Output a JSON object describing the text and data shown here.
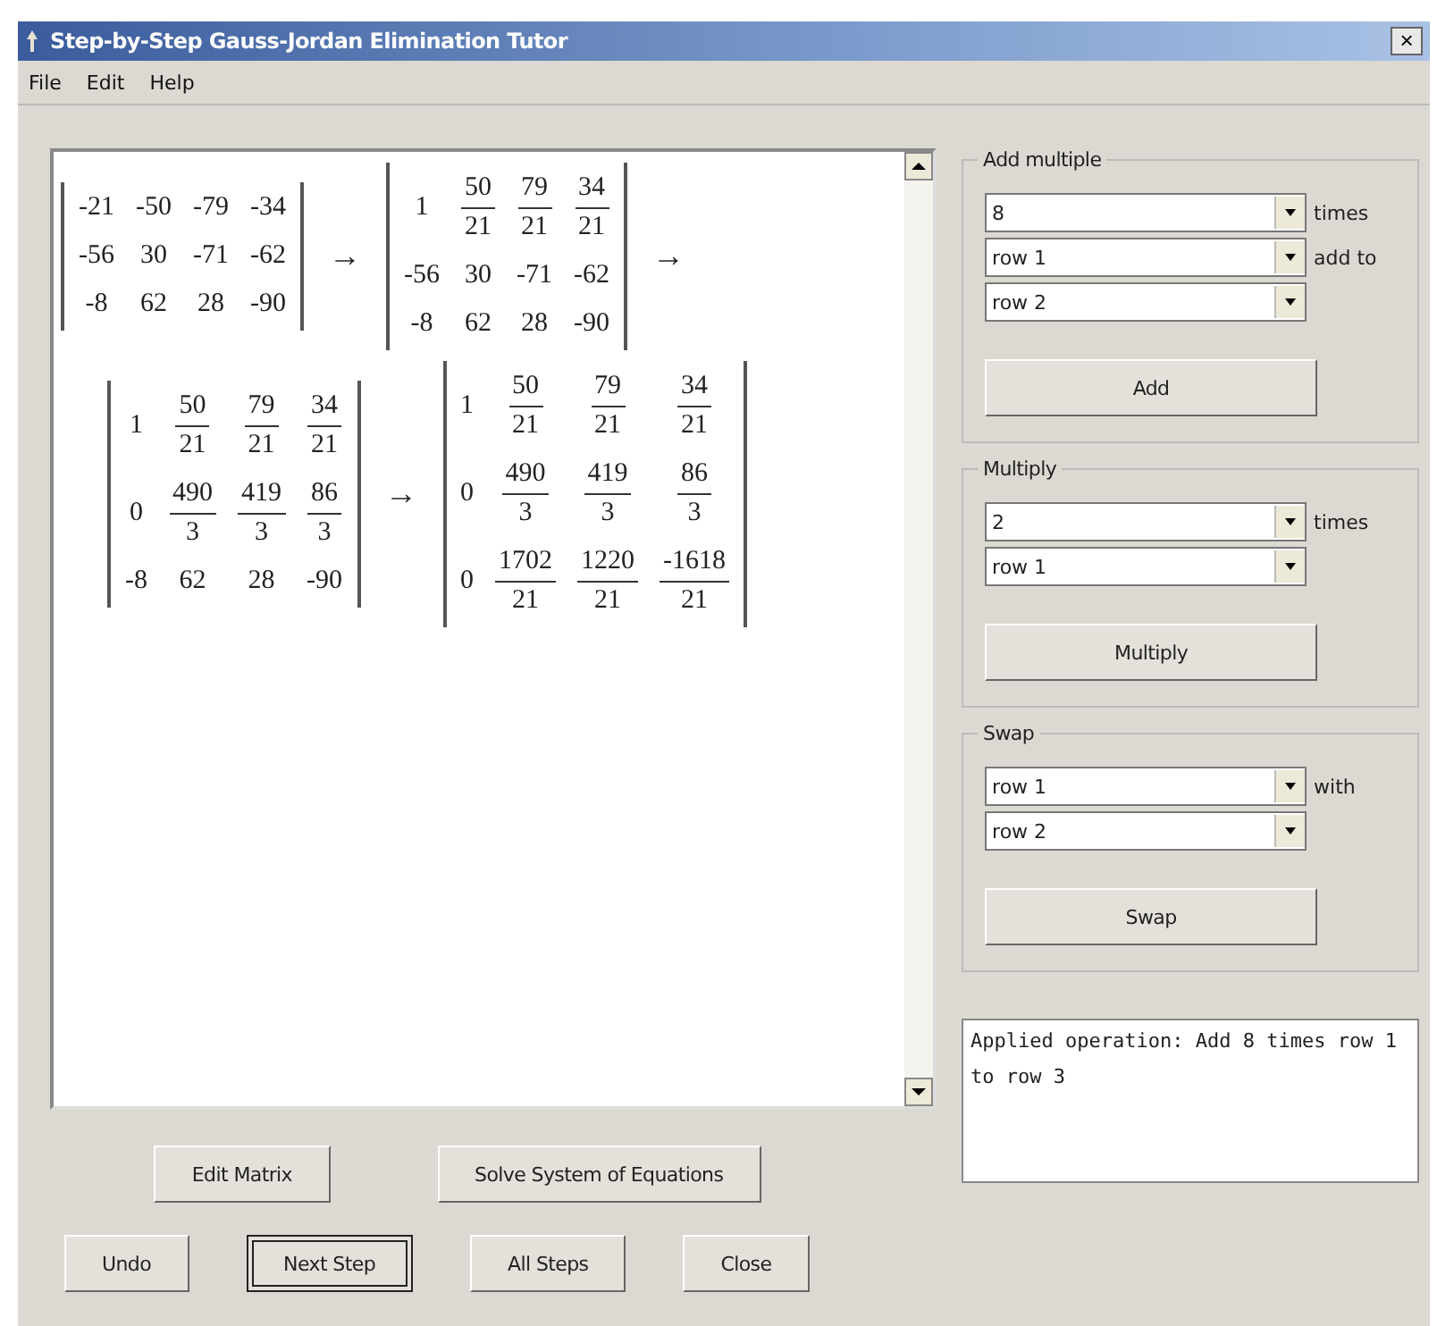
{
  "window": {
    "title": "Step-by-Step Gauss-Jordan Elimination Tutor",
    "close": "×"
  },
  "menu": [
    "File",
    "Edit",
    "Help"
  ],
  "steps": [
    [
      {
        "kind": "matrix",
        "rows": [
          [
            {
              "kind": "int",
              "text": "-21"
            },
            {
              "kind": "int",
              "text": "-50"
            },
            {
              "kind": "int",
              "text": "-79"
            },
            {
              "kind": "int",
              "text": "-34"
            }
          ],
          [
            {
              "kind": "int",
              "text": "-56"
            },
            {
              "kind": "int",
              "text": "30"
            },
            {
              "kind": "int",
              "text": "-71"
            },
            {
              "kind": "int",
              "text": "-62"
            }
          ],
          [
            {
              "kind": "int",
              "text": "-8"
            },
            {
              "kind": "int",
              "text": "62"
            },
            {
              "kind": "int",
              "text": "28"
            },
            {
              "kind": "int",
              "text": "-90"
            }
          ]
        ]
      },
      {
        "kind": "arrow",
        "text": "→"
      },
      {
        "kind": "matrix",
        "rows": [
          [
            {
              "kind": "int",
              "text": "1"
            },
            {
              "kind": "frac",
              "num": "50",
              "den": "21"
            },
            {
              "kind": "frac",
              "num": "79",
              "den": "21"
            },
            {
              "kind": "frac",
              "num": "34",
              "den": "21"
            }
          ],
          [
            {
              "kind": "int",
              "text": "-56"
            },
            {
              "kind": "int",
              "text": "30"
            },
            {
              "kind": "int",
              "text": "-71"
            },
            {
              "kind": "int",
              "text": "-62"
            }
          ],
          [
            {
              "kind": "int",
              "text": "-8"
            },
            {
              "kind": "int",
              "text": "62"
            },
            {
              "kind": "int",
              "text": "28"
            },
            {
              "kind": "int",
              "text": "-90"
            }
          ]
        ]
      },
      {
        "kind": "arrow",
        "text": "→"
      }
    ],
    [
      {
        "kind": "matrix",
        "rows": [
          [
            {
              "kind": "int",
              "text": "1"
            },
            {
              "kind": "frac",
              "num": "50",
              "den": "21"
            },
            {
              "kind": "frac",
              "num": "79",
              "den": "21"
            },
            {
              "kind": "frac",
              "num": "34",
              "den": "21"
            }
          ],
          [
            {
              "kind": "int",
              "text": "0"
            },
            {
              "kind": "frac",
              "num": "490",
              "den": "3"
            },
            {
              "kind": "frac",
              "num": "419",
              "den": "3"
            },
            {
              "kind": "frac",
              "num": "86",
              "den": "3"
            }
          ],
          [
            {
              "kind": "int",
              "text": "-8"
            },
            {
              "kind": "int",
              "text": "62"
            },
            {
              "kind": "int",
              "text": "28"
            },
            {
              "kind": "int",
              "text": "-90"
            }
          ]
        ]
      },
      {
        "kind": "arrow",
        "text": "→"
      },
      {
        "kind": "matrix",
        "rows": [
          [
            {
              "kind": "int",
              "text": "1"
            },
            {
              "kind": "frac",
              "num": "50",
              "den": "21"
            },
            {
              "kind": "frac",
              "num": "79",
              "den": "21"
            },
            {
              "kind": "frac",
              "num": "34",
              "den": "21"
            }
          ],
          [
            {
              "kind": "int",
              "text": "0"
            },
            {
              "kind": "frac",
              "num": "490",
              "den": "3"
            },
            {
              "kind": "frac",
              "num": "419",
              "den": "3"
            },
            {
              "kind": "frac",
              "num": "86",
              "den": "3"
            }
          ],
          [
            {
              "kind": "int",
              "text": "0"
            },
            {
              "kind": "frac",
              "num": "1702",
              "den": "21"
            },
            {
              "kind": "frac",
              "num": "1220",
              "den": "21"
            },
            {
              "kind": "frac",
              "num": "-1618",
              "den": "21"
            }
          ]
        ]
      }
    ]
  ],
  "groups": [
    {
      "title": "Add multiple",
      "combos": [
        {
          "value": "8",
          "label": "times"
        },
        {
          "value": "row 1",
          "label": "add to"
        },
        {
          "value": "row 2"
        }
      ],
      "button": "Add"
    },
    {
      "title": "Multiply",
      "combos": [
        {
          "value": "2",
          "label": "times"
        },
        {
          "value": "row 1"
        }
      ],
      "button": "Multiply"
    },
    {
      "title": "Swap",
      "combos": [
        {
          "value": "row 1",
          "label": "with"
        },
        {
          "value": "row 2"
        }
      ],
      "button": "Swap"
    }
  ],
  "buttons_top": [
    {
      "label": "Edit Matrix",
      "focused": false
    },
    {
      "label": "Solve System of Equations",
      "focused": false
    }
  ],
  "buttons_bottom": [
    {
      "label": "Undo",
      "focused": false
    },
    {
      "label": "Next Step",
      "focused": true
    },
    {
      "label": "All Steps",
      "focused": false
    },
    {
      "label": "Close",
      "focused": false
    }
  ],
  "output": "Applied operation: Add 8 times row 1 to row 3"
}
